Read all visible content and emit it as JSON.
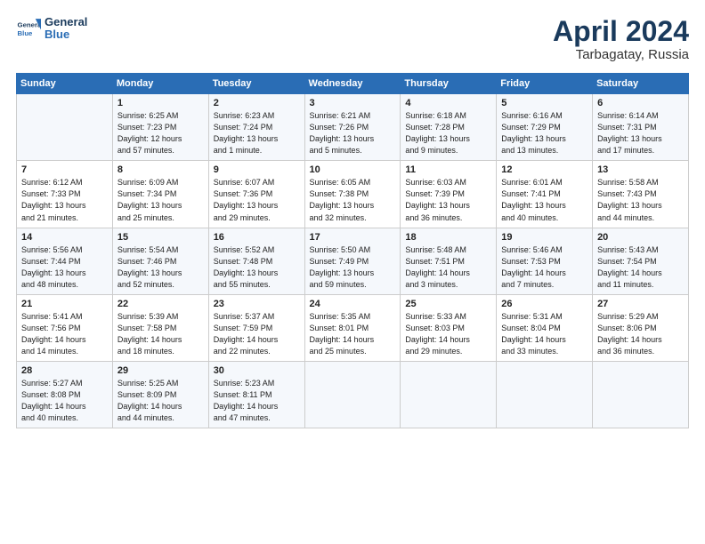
{
  "logo": {
    "line1": "General",
    "line2": "Blue"
  },
  "title": "April 2024",
  "location": "Tarbagatay, Russia",
  "days_header": [
    "Sunday",
    "Monday",
    "Tuesday",
    "Wednesday",
    "Thursday",
    "Friday",
    "Saturday"
  ],
  "weeks": [
    [
      {
        "day": "",
        "info": ""
      },
      {
        "day": "1",
        "info": "Sunrise: 6:25 AM\nSunset: 7:23 PM\nDaylight: 12 hours\nand 57 minutes."
      },
      {
        "day": "2",
        "info": "Sunrise: 6:23 AM\nSunset: 7:24 PM\nDaylight: 13 hours\nand 1 minute."
      },
      {
        "day": "3",
        "info": "Sunrise: 6:21 AM\nSunset: 7:26 PM\nDaylight: 13 hours\nand 5 minutes."
      },
      {
        "day": "4",
        "info": "Sunrise: 6:18 AM\nSunset: 7:28 PM\nDaylight: 13 hours\nand 9 minutes."
      },
      {
        "day": "5",
        "info": "Sunrise: 6:16 AM\nSunset: 7:29 PM\nDaylight: 13 hours\nand 13 minutes."
      },
      {
        "day": "6",
        "info": "Sunrise: 6:14 AM\nSunset: 7:31 PM\nDaylight: 13 hours\nand 17 minutes."
      }
    ],
    [
      {
        "day": "7",
        "info": "Sunrise: 6:12 AM\nSunset: 7:33 PM\nDaylight: 13 hours\nand 21 minutes."
      },
      {
        "day": "8",
        "info": "Sunrise: 6:09 AM\nSunset: 7:34 PM\nDaylight: 13 hours\nand 25 minutes."
      },
      {
        "day": "9",
        "info": "Sunrise: 6:07 AM\nSunset: 7:36 PM\nDaylight: 13 hours\nand 29 minutes."
      },
      {
        "day": "10",
        "info": "Sunrise: 6:05 AM\nSunset: 7:38 PM\nDaylight: 13 hours\nand 32 minutes."
      },
      {
        "day": "11",
        "info": "Sunrise: 6:03 AM\nSunset: 7:39 PM\nDaylight: 13 hours\nand 36 minutes."
      },
      {
        "day": "12",
        "info": "Sunrise: 6:01 AM\nSunset: 7:41 PM\nDaylight: 13 hours\nand 40 minutes."
      },
      {
        "day": "13",
        "info": "Sunrise: 5:58 AM\nSunset: 7:43 PM\nDaylight: 13 hours\nand 44 minutes."
      }
    ],
    [
      {
        "day": "14",
        "info": "Sunrise: 5:56 AM\nSunset: 7:44 PM\nDaylight: 13 hours\nand 48 minutes."
      },
      {
        "day": "15",
        "info": "Sunrise: 5:54 AM\nSunset: 7:46 PM\nDaylight: 13 hours\nand 52 minutes."
      },
      {
        "day": "16",
        "info": "Sunrise: 5:52 AM\nSunset: 7:48 PM\nDaylight: 13 hours\nand 55 minutes."
      },
      {
        "day": "17",
        "info": "Sunrise: 5:50 AM\nSunset: 7:49 PM\nDaylight: 13 hours\nand 59 minutes."
      },
      {
        "day": "18",
        "info": "Sunrise: 5:48 AM\nSunset: 7:51 PM\nDaylight: 14 hours\nand 3 minutes."
      },
      {
        "day": "19",
        "info": "Sunrise: 5:46 AM\nSunset: 7:53 PM\nDaylight: 14 hours\nand 7 minutes."
      },
      {
        "day": "20",
        "info": "Sunrise: 5:43 AM\nSunset: 7:54 PM\nDaylight: 14 hours\nand 11 minutes."
      }
    ],
    [
      {
        "day": "21",
        "info": "Sunrise: 5:41 AM\nSunset: 7:56 PM\nDaylight: 14 hours\nand 14 minutes."
      },
      {
        "day": "22",
        "info": "Sunrise: 5:39 AM\nSunset: 7:58 PM\nDaylight: 14 hours\nand 18 minutes."
      },
      {
        "day": "23",
        "info": "Sunrise: 5:37 AM\nSunset: 7:59 PM\nDaylight: 14 hours\nand 22 minutes."
      },
      {
        "day": "24",
        "info": "Sunrise: 5:35 AM\nSunset: 8:01 PM\nDaylight: 14 hours\nand 25 minutes."
      },
      {
        "day": "25",
        "info": "Sunrise: 5:33 AM\nSunset: 8:03 PM\nDaylight: 14 hours\nand 29 minutes."
      },
      {
        "day": "26",
        "info": "Sunrise: 5:31 AM\nSunset: 8:04 PM\nDaylight: 14 hours\nand 33 minutes."
      },
      {
        "day": "27",
        "info": "Sunrise: 5:29 AM\nSunset: 8:06 PM\nDaylight: 14 hours\nand 36 minutes."
      }
    ],
    [
      {
        "day": "28",
        "info": "Sunrise: 5:27 AM\nSunset: 8:08 PM\nDaylight: 14 hours\nand 40 minutes."
      },
      {
        "day": "29",
        "info": "Sunrise: 5:25 AM\nSunset: 8:09 PM\nDaylight: 14 hours\nand 44 minutes."
      },
      {
        "day": "30",
        "info": "Sunrise: 5:23 AM\nSunset: 8:11 PM\nDaylight: 14 hours\nand 47 minutes."
      },
      {
        "day": "",
        "info": ""
      },
      {
        "day": "",
        "info": ""
      },
      {
        "day": "",
        "info": ""
      },
      {
        "day": "",
        "info": ""
      }
    ]
  ]
}
